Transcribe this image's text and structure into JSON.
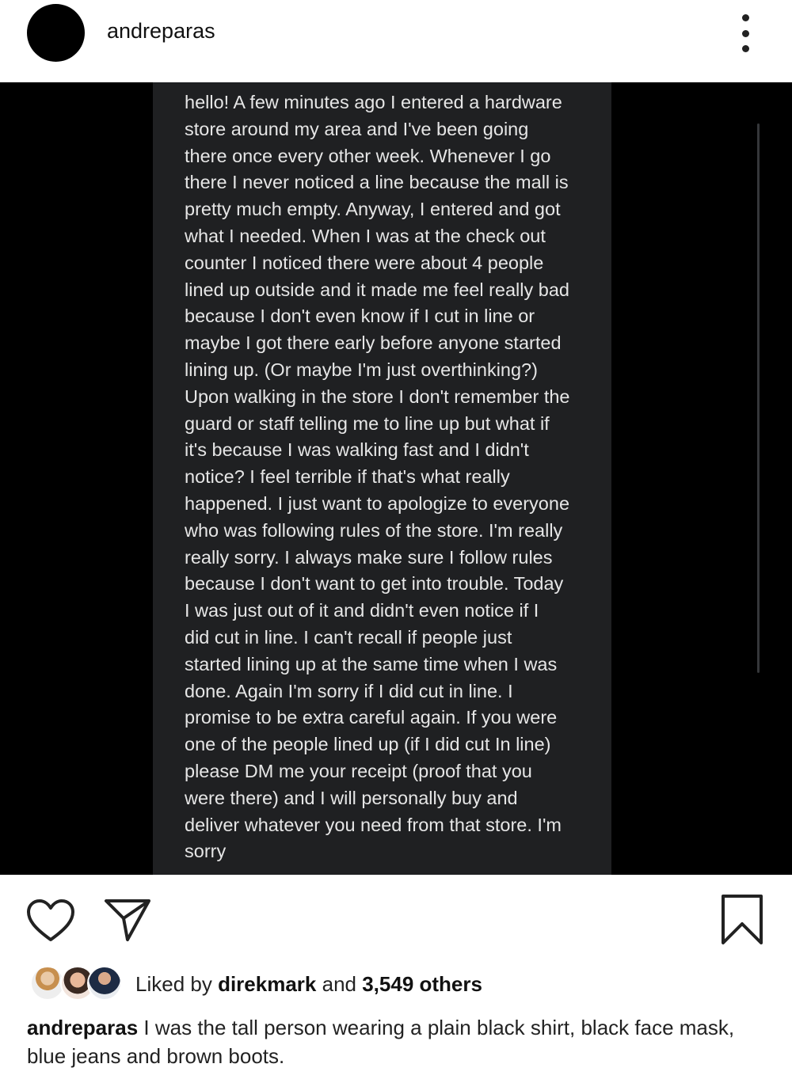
{
  "header": {
    "username": "andreparas",
    "more_icon": "more-vertical-icon"
  },
  "post": {
    "note_text": "hello! A few minutes ago I entered a hardware\nstore around my area and I've been going\nthere once every other week. Whenever I go\nthere I never noticed a line because the mall is\npretty much empty. Anyway, I entered and got\nwhat I needed. When I was at the check out\ncounter I noticed there were about 4 people\nlined up outside and it made me feel really bad\nbecause I don't even know if I cut in line or\nmaybe I got there early before anyone started\nlining up. (Or maybe I'm just overthinking?)\nUpon walking in the store I don't remember the\nguard or staff telling me to line up but what if\nit's because I was walking fast and I didn't\nnotice? I feel terrible if that's what really\nhappened. I just want to apologize to everyone\nwho was following rules of the store. I'm really\nreally sorry. I always make sure I follow rules\nbecause I don't want to get into trouble. Today\nI was just out of it and didn't even notice if I\ndid cut in line. I can't recall if people just\nstarted lining up at the same time when I was\ndone. Again I'm sorry if I did cut in line. I\npromise to be extra careful again.  If you were\none of the people lined up (if I did cut In line)\nplease DM me your receipt (proof that you\nwere there) and I will personally buy and\ndeliver whatever you need from that store. I'm\nsorry"
  },
  "actions": {
    "like_icon": "heart-icon",
    "share_icon": "send-icon",
    "save_icon": "bookmark-icon"
  },
  "likes": {
    "prefix": "Liked by ",
    "first_liker": "direkmark",
    "middle": " and ",
    "others": "3,549 others"
  },
  "caption": {
    "username": "andreparas",
    "text": " I was the tall person wearing a plain black shirt, black face mask, blue jeans and brown boots."
  }
}
